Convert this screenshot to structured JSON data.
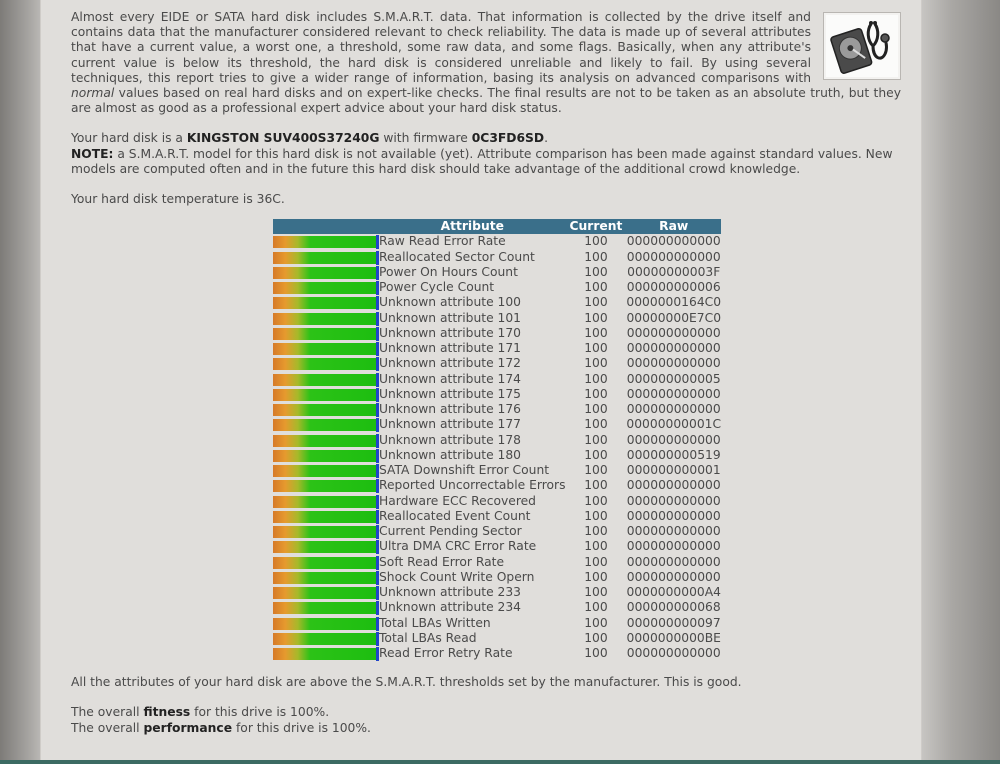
{
  "intro": {
    "text_before_em": "Almost every EIDE or SATA hard disk includes S.M.A.R.T. data. That information is collected by the drive itself and contains data that the manufacturer considered relevant to check reliability. The data is made up of several attributes that have a current value, a worst one, a threshold, some raw data, and some flags. Basically, when any attribute's current value is below its threshold, the hard disk is considered unreliable and likely to fail. By using several techniques, this report tries to give a wider range of information, basing its analysis on advanced comparisons with ",
    "em_text": "normal",
    "text_after_em": " values based on real hard disks and on expert-like checks. The final results are not to be taken as an absolute truth, but they are almost as good as a professional expert advice about your hard disk status."
  },
  "disk": {
    "prefix": "Your hard disk is a ",
    "model": "KINGSTON SUV400S37240G",
    "firmware_prefix": " with firmware ",
    "firmware": "0C3FD6SD",
    "firmware_suffix": "."
  },
  "note": {
    "label": "NOTE:",
    "text": " a S.M.A.R.T. model for this hard disk is not available (yet). Attribute comparison has been made against standard values. New models are computed often and in the future this hard disk should take advantage of the additional crowd knowledge."
  },
  "temperature_text": "Your hard disk temperature is 36C.",
  "table": {
    "headers": {
      "attribute": "Attribute",
      "current": "Current",
      "raw": "Raw"
    },
    "rows": [
      {
        "attribute": "Raw Read Error Rate",
        "current": "100",
        "raw": "000000000000",
        "health": 1.0
      },
      {
        "attribute": "Reallocated Sector Count",
        "current": "100",
        "raw": "000000000000",
        "health": 1.0
      },
      {
        "attribute": "Power On Hours Count",
        "current": "100",
        "raw": "00000000003F",
        "health": 1.0
      },
      {
        "attribute": "Power Cycle Count",
        "current": "100",
        "raw": "000000000006",
        "health": 1.0
      },
      {
        "attribute": "Unknown attribute 100",
        "current": "100",
        "raw": "0000000164C0",
        "health": 1.0
      },
      {
        "attribute": "Unknown attribute 101",
        "current": "100",
        "raw": "00000000E7C0",
        "health": 1.0
      },
      {
        "attribute": "Unknown attribute 170",
        "current": "100",
        "raw": "000000000000",
        "health": 1.0
      },
      {
        "attribute": "Unknown attribute 171",
        "current": "100",
        "raw": "000000000000",
        "health": 1.0
      },
      {
        "attribute": "Unknown attribute 172",
        "current": "100",
        "raw": "000000000000",
        "health": 1.0
      },
      {
        "attribute": "Unknown attribute 174",
        "current": "100",
        "raw": "000000000005",
        "health": 1.0
      },
      {
        "attribute": "Unknown attribute 175",
        "current": "100",
        "raw": "000000000000",
        "health": 1.0
      },
      {
        "attribute": "Unknown attribute 176",
        "current": "100",
        "raw": "000000000000",
        "health": 1.0
      },
      {
        "attribute": "Unknown attribute 177",
        "current": "100",
        "raw": "00000000001C",
        "health": 1.0
      },
      {
        "attribute": "Unknown attribute 178",
        "current": "100",
        "raw": "000000000000",
        "health": 1.0
      },
      {
        "attribute": "Unknown attribute 180",
        "current": "100",
        "raw": "000000000519",
        "health": 1.0
      },
      {
        "attribute": "SATA Downshift Error Count",
        "current": "100",
        "raw": "000000000001",
        "health": 1.0
      },
      {
        "attribute": "Reported Uncorrectable Errors",
        "current": "100",
        "raw": "000000000000",
        "health": 1.0
      },
      {
        "attribute": "Hardware ECC Recovered",
        "current": "100",
        "raw": "000000000000",
        "health": 1.0
      },
      {
        "attribute": "Reallocated Event Count",
        "current": "100",
        "raw": "000000000000",
        "health": 1.0
      },
      {
        "attribute": "Current Pending Sector",
        "current": "100",
        "raw": "000000000000",
        "health": 1.0
      },
      {
        "attribute": "Ultra DMA CRC Error Rate",
        "current": "100",
        "raw": "000000000000",
        "health": 1.0
      },
      {
        "attribute": "Soft Read Error Rate",
        "current": "100",
        "raw": "000000000000",
        "health": 1.0
      },
      {
        "attribute": "Shock Count Write Opern",
        "current": "100",
        "raw": "000000000000",
        "health": 1.0
      },
      {
        "attribute": "Unknown attribute 233",
        "current": "100",
        "raw": "0000000000A4",
        "health": 1.0
      },
      {
        "attribute": "Unknown attribute 234",
        "current": "100",
        "raw": "000000000068",
        "health": 1.0
      },
      {
        "attribute": "Total LBAs Written",
        "current": "100",
        "raw": "000000000097",
        "health": 1.0
      },
      {
        "attribute": "Total LBAs Read",
        "current": "100",
        "raw": "0000000000BE",
        "health": 1.0
      },
      {
        "attribute": "Read Error Retry Rate",
        "current": "100",
        "raw": "000000000000",
        "health": 1.0
      }
    ]
  },
  "summary": "All the attributes of your hard disk are above the S.M.A.R.T. thresholds set by the manufacturer. This is good.",
  "fitness": {
    "prefix": "The overall ",
    "label": "fitness",
    "suffix": " for this drive is 100%."
  },
  "performance": {
    "prefix": "The overall ",
    "label": "performance",
    "suffix": " for this drive is 100%."
  },
  "icons": {
    "logo": "hard-disk-stethoscope-icon"
  },
  "colors": {
    "table_header": "#3a6f8a",
    "bar_good": "#1dbe10",
    "bar_marker": "#2145c9"
  }
}
